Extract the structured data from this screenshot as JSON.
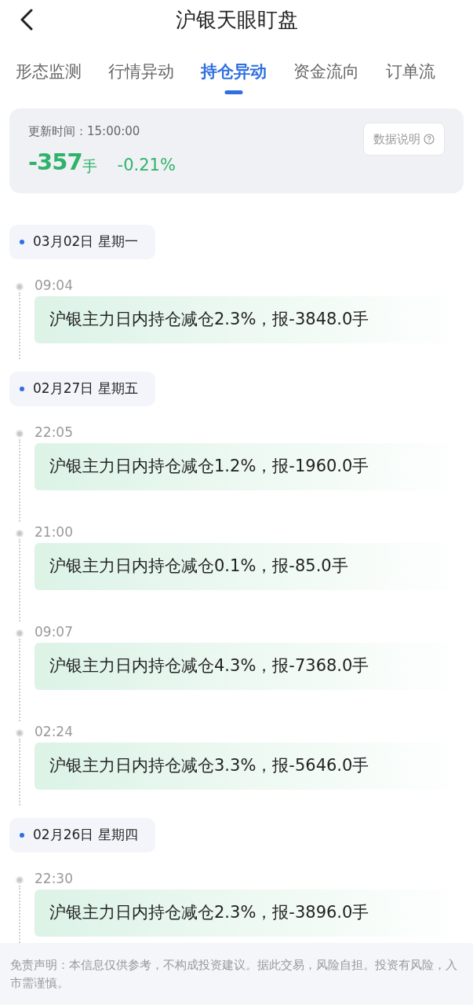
{
  "header": {
    "title": "沪银天眼盯盘"
  },
  "tabs": [
    {
      "label": "形态监测",
      "selected": false
    },
    {
      "label": "行情异动",
      "selected": false
    },
    {
      "label": "持仓异动",
      "selected": true
    },
    {
      "label": "资金流向",
      "selected": false
    },
    {
      "label": "订单流",
      "selected": false
    }
  ],
  "summary": {
    "update_time": "更新时间：15:00:00",
    "change_value": "-357",
    "change_unit": "手",
    "change_percent": "-0.21%",
    "info_button": "数据说明"
  },
  "timeline": [
    {
      "date": "03月02日 星期一",
      "events": [
        {
          "time": "09:04",
          "text": "沪银主力日内持仓减仓2.3%，报-3848.0手"
        }
      ]
    },
    {
      "date": "02月27日 星期五",
      "events": [
        {
          "time": "22:05",
          "text": "沪银主力日内持仓减仓1.2%，报-1960.0手"
        },
        {
          "time": "21:00",
          "text": "沪银主力日内持仓减仓0.1%，报-85.0手"
        },
        {
          "time": "09:07",
          "text": "沪银主力日内持仓减仓4.3%，报-7368.0手"
        },
        {
          "time": "02:24",
          "text": "沪银主力日内持仓减仓3.3%，报-5646.0手"
        }
      ]
    },
    {
      "date": "02月26日 星期四",
      "events": [
        {
          "time": "22:30",
          "text": "沪银主力日内持仓减仓2.3%，报-3896.0手"
        }
      ]
    }
  ],
  "disclaimer": "免责声明：本信息仅供参考，不构成投资建议。据此交易，风险自担。投资有风险，入市需谨慎。"
}
